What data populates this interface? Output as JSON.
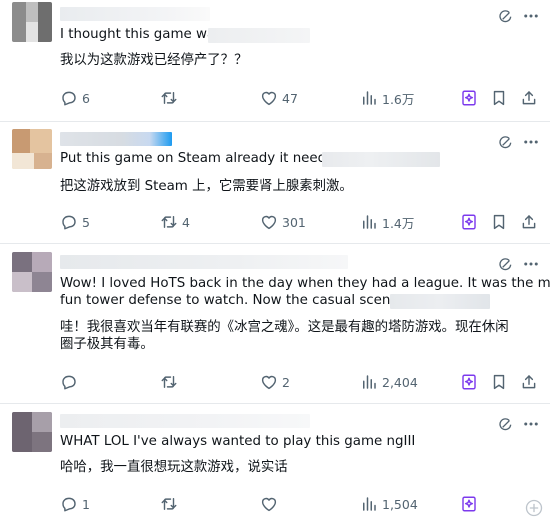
{
  "replies": [
    {
      "text_en": "I thought this game was",
      "text_zh": "我以为这款游戏已经停产了？？",
      "replies": "6",
      "reposts": "",
      "likes": "47",
      "views": "1.6万"
    },
    {
      "text_en": "Put this game on Steam already it needs t",
      "text_zh": "把这游戏放到 Steam 上，它需要肾上腺素刺激。",
      "replies": "5",
      "reposts": "4",
      "likes": "301",
      "views": "1.4万"
    },
    {
      "text_en_1": "Wow! I loved HoTS back in the day when they had a league. It was the most",
      "text_en_2": "fun tower defense to watch. Now the casual scene is",
      "text_zh_1": "哇！我很喜欢当年有联赛的《冰宫之魂》。这是最有趣的塔防游戏。现在休闲",
      "text_zh_2": "圈子极其有毒。",
      "replies": "",
      "reposts": "",
      "likes": "2",
      "views": "2,404"
    },
    {
      "text_en": "WHAT LOL I've always wanted to play this game ngIII",
      "text_zh": "哈哈，我一直很想玩这款游戏，说实话",
      "replies": "1",
      "reposts": "",
      "likes": "",
      "views": "1,504"
    }
  ],
  "icons": {
    "reply": "reply-icon",
    "repost": "repost-icon",
    "like": "heart-icon",
    "views": "views-icon",
    "grok": "grok-icon",
    "bookmark": "bookmark-icon",
    "share": "share-icon",
    "more": "more-icon"
  },
  "colors": {
    "text": "#0f1419",
    "muted": "#536471",
    "grok": "#7c3aed",
    "divider": "#e6e9ec"
  }
}
